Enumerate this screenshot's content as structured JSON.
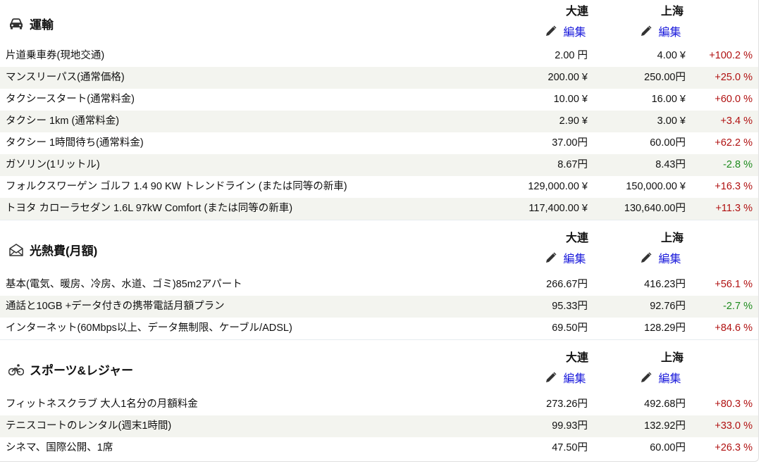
{
  "colors": {
    "increase": "#b01010",
    "decrease": "#1d8a1d",
    "edit_link": "#1a1adb",
    "alt_row": "#f3f4ef"
  },
  "sections": [
    {
      "icon": "car-icon",
      "title": "運輸",
      "city1": "大連",
      "city2": "上海",
      "edit_label": "編集",
      "rows": [
        {
          "name": "片道乗車券(現地交通)",
          "v1": "2.00 円",
          "v2": "4.00 ¥",
          "pct": "+100.2 %",
          "dir": "up"
        },
        {
          "name": "マンスリーパス(通常価格)",
          "v1": "200.00 ¥",
          "v2": "250.00円",
          "pct": "+25.0 %",
          "dir": "up"
        },
        {
          "name": "タクシースタート(通常料金)",
          "v1": "10.00 ¥",
          "v2": "16.00 ¥",
          "pct": "+60.0 %",
          "dir": "up"
        },
        {
          "name": "タクシー 1km (通常料金)",
          "v1": "2.90 ¥",
          "v2": "3.00 ¥",
          "pct": "+3.4 %",
          "dir": "up"
        },
        {
          "name": "タクシー 1時間待ち(通常料金)",
          "v1": "37.00円",
          "v2": "60.00円",
          "pct": "+62.2 %",
          "dir": "up"
        },
        {
          "name": "ガソリン(1リットル)",
          "v1": "8.67円",
          "v2": "8.43円",
          "pct": "-2.8 %",
          "dir": "down"
        },
        {
          "name": "フォルクスワーゲン ゴルフ 1.4 90 KW トレンドライン (または同等の新車)",
          "v1": "129,000.00 ¥",
          "v2": "150,000.00 ¥",
          "pct": "+16.3 %",
          "dir": "up"
        },
        {
          "name": "トヨタ カローラセダン 1.6L 97kW Comfort (または同等の新車)",
          "v1": "117,400.00 ¥",
          "v2": "130,640.00円",
          "pct": "+11.3 %",
          "dir": "up"
        }
      ]
    },
    {
      "icon": "envelope-icon",
      "title": "光熱費(月額)",
      "city1": "大連",
      "city2": "上海",
      "edit_label": "編集",
      "rows": [
        {
          "name": "基本(電気、暖房、冷房、水道、ゴミ)85m2アパート",
          "v1": "266.67円",
          "v2": "416.23円",
          "pct": "+56.1 %",
          "dir": "up"
        },
        {
          "name": "通話と10GB +データ付きの携帯電話月額プラン",
          "v1": "95.33円",
          "v2": "92.76円",
          "pct": "-2.7 %",
          "dir": "down"
        },
        {
          "name": "インターネット(60Mbps以上、データ無制限、ケーブル/ADSL)",
          "v1": "69.50円",
          "v2": "128.29円",
          "pct": "+84.6 %",
          "dir": "up"
        }
      ]
    },
    {
      "icon": "bicycle-icon",
      "title": "スポーツ&レジャー",
      "city1": "大連",
      "city2": "上海",
      "edit_label": "編集",
      "rows": [
        {
          "name": "フィットネスクラブ 大人1名分の月額料金",
          "v1": "273.26円",
          "v2": "492.68円",
          "pct": "+80.3 %",
          "dir": "up"
        },
        {
          "name": "テニスコートのレンタル(週末1時間)",
          "v1": "99.93円",
          "v2": "132.92円",
          "pct": "+33.0 %",
          "dir": "up"
        },
        {
          "name": "シネマ、国際公開、1席",
          "v1": "47.50円",
          "v2": "60.00円",
          "pct": "+26.3 %",
          "dir": "up"
        }
      ]
    }
  ]
}
